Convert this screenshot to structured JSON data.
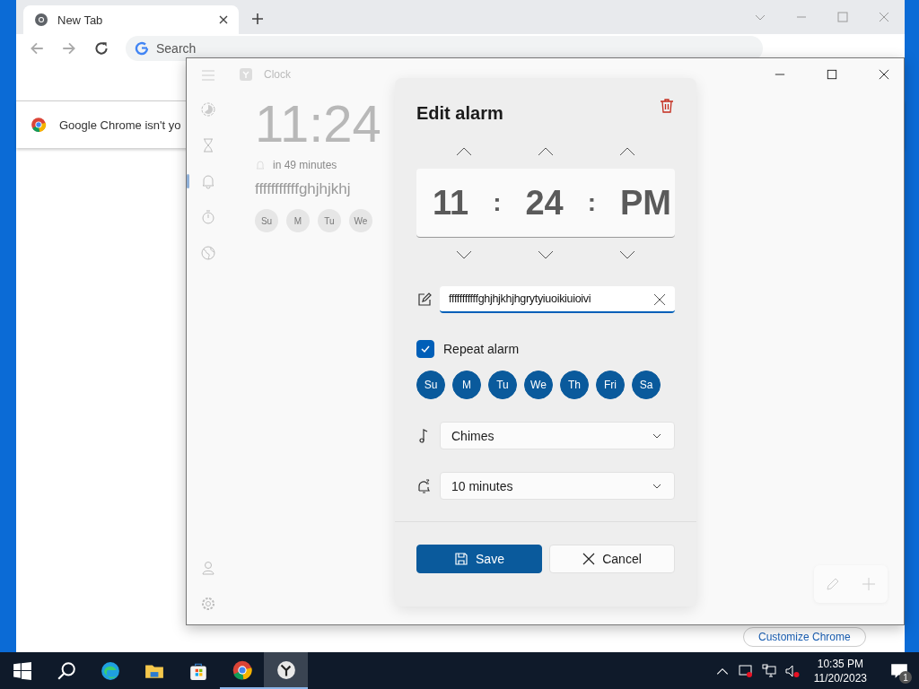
{
  "chrome": {
    "tab": {
      "title": "New Tab",
      "selected": true
    },
    "omnibox_placeholder": "Search",
    "infobar": "Google Chrome isn't yo",
    "customize_button": "Customize Chrome"
  },
  "clock_app": {
    "title": "Clock",
    "nav": [
      {
        "kind": "focus",
        "selected": false
      },
      {
        "kind": "timer",
        "selected": false
      },
      {
        "kind": "alarm",
        "selected": true
      },
      {
        "kind": "stopwatch",
        "selected": false
      },
      {
        "kind": "world",
        "selected": false
      }
    ],
    "alarm_card": {
      "time": "11:24",
      "due": "in 49 minutes",
      "name": "fffffffffffghjhjkhj",
      "days": [
        "Su",
        "M",
        "Tu",
        "We"
      ]
    }
  },
  "dialog": {
    "title": "Edit alarm",
    "hour": "11",
    "minute": "24",
    "period": "PM",
    "separator": ":",
    "name_value": "fffffffffffghjhjkhjhgrytyiuoikiuioivi",
    "repeat": {
      "label": "Repeat alarm",
      "checked": true
    },
    "days": [
      {
        "label": "Su",
        "selected": true
      },
      {
        "label": "M",
        "selected": true
      },
      {
        "label": "Tu",
        "selected": true
      },
      {
        "label": "We",
        "selected": true
      },
      {
        "label": "Th",
        "selected": true
      },
      {
        "label": "Fri",
        "selected": true
      },
      {
        "label": "Sa",
        "selected": true
      }
    ],
    "sound": "Chimes",
    "snooze": "10 minutes",
    "save": "Save",
    "cancel": "Cancel"
  },
  "taskbar": {
    "apps": [
      {
        "kind": "start",
        "running": false,
        "selected": false
      },
      {
        "kind": "search",
        "running": false,
        "selected": false
      },
      {
        "kind": "edge",
        "running": false,
        "selected": false
      },
      {
        "kind": "explorer",
        "running": false,
        "selected": false
      },
      {
        "kind": "store",
        "running": false,
        "selected": false
      },
      {
        "kind": "chrome",
        "running": true,
        "selected": false
      },
      {
        "kind": "clock",
        "running": true,
        "selected": true
      }
    ],
    "time": "10:35 PM",
    "date": "11/20/2023",
    "notifications": "1"
  }
}
